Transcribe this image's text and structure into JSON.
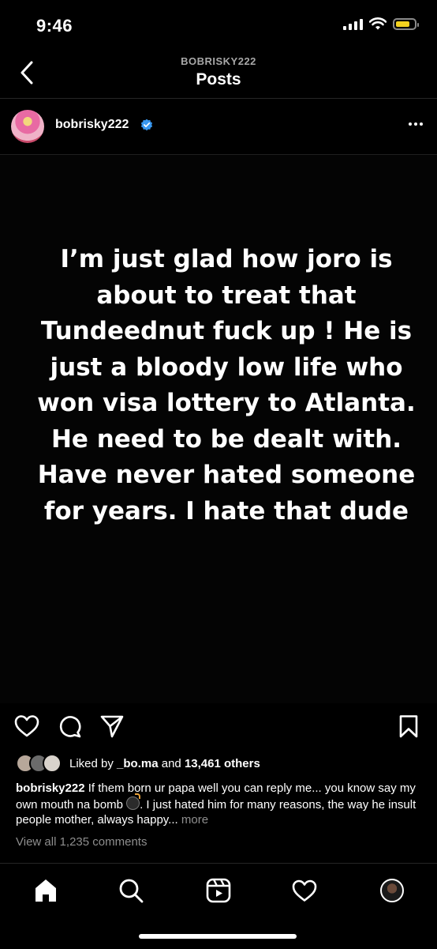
{
  "status_bar": {
    "time": "9:46",
    "battery_level": 0.75,
    "battery_color": "#f4d21f"
  },
  "header": {
    "account": "BOBRISKY222",
    "title": "Posts"
  },
  "post": {
    "username": "bobrisky222",
    "verified": true,
    "image_text": "I’m just glad how joro is about to treat that Tundeednut fuck up ! He is just a bloody low life who won visa lottery to Atlanta. He need to be dealt with. Have never hated someone for years. I hate that dude",
    "liked_by_prefix": "Liked by ",
    "liked_by_user": "_bo.ma",
    "liked_by_and": " and ",
    "liked_by_others": "13,461 others",
    "caption_user": "bobrisky222",
    "caption_text_1": " If them born ur papa well you can reply me... you know say my own mouth na bomb ",
    "caption_emoji": "bomb",
    "caption_text_2": ". I just hated him for many reasons, the way he insult people mother, always happy...",
    "caption_more": "more",
    "view_comments": "View all 1,235 comments"
  },
  "icons": {
    "back": "chevron-left-icon",
    "verified": "verified-badge-icon",
    "more": "more-horizontal-icon",
    "like": "heart-icon",
    "comment": "comment-icon",
    "share": "send-icon",
    "save": "bookmark-icon",
    "home": "home-icon",
    "search": "search-icon",
    "reels": "reels-icon",
    "activity": "heart-icon",
    "profile": "profile-avatar"
  },
  "colors": {
    "background": "#000000",
    "text": "#ffffff",
    "muted": "#8e8e8e",
    "verified": "#3897f0"
  }
}
